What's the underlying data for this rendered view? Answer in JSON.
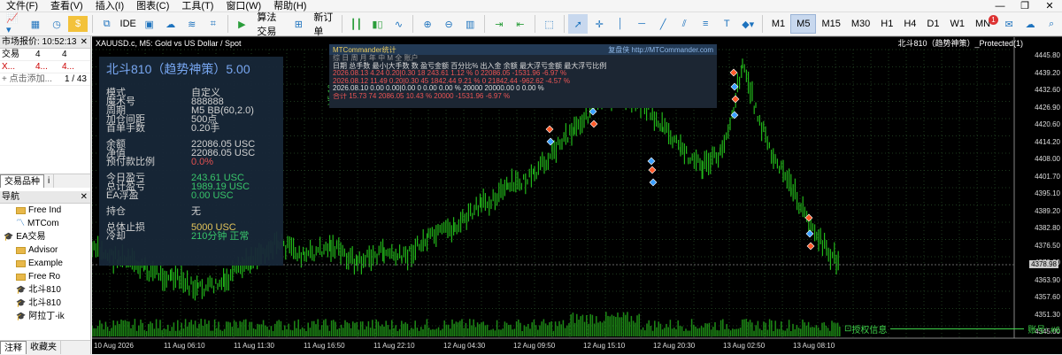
{
  "menu": {
    "items": [
      "文件(F)",
      "查看(V)",
      "插入(I)",
      "图表(C)",
      "工具(T)",
      "窗口(W)",
      "帮助(H)"
    ],
    "win_controls": [
      "—",
      "❐",
      "✕"
    ]
  },
  "toolbar": {
    "ide_label": "IDE",
    "algo_label": "算法交易",
    "new_order_label": "新订单",
    "timeframes": [
      "M1",
      "M5",
      "M15",
      "M30",
      "H1",
      "H4",
      "D1",
      "W1",
      "MN"
    ],
    "active_timeframe": "M5",
    "notify_count": "1"
  },
  "market_watch": {
    "title": "市场报价: 10:52:13",
    "col1": "交易",
    "col2": "4",
    "row_symbol": "X...",
    "row_bid": "4...",
    "row_ask": "4...",
    "add_label": "+ 点击添加...",
    "count": "1 / 43"
  },
  "left_tabs": {
    "tab1": "交易品种",
    "tab2": "i"
  },
  "navigator": {
    "title": "导航",
    "items": [
      {
        "label": "Free Ind",
        "type": "folder"
      },
      {
        "label": "MTCom",
        "type": "ind"
      },
      {
        "label": "EA交易",
        "type": "ea"
      },
      {
        "label": "Advisor",
        "type": "folder"
      },
      {
        "label": "Example",
        "type": "folder"
      },
      {
        "label": "Free Ro",
        "type": "folder"
      },
      {
        "label": "北斗810",
        "type": "ea"
      },
      {
        "label": "北斗810",
        "type": "ea"
      },
      {
        "label": "阿拉丁-ik",
        "type": "ea"
      }
    ]
  },
  "bottom_tabs": {
    "tab1": "注释",
    "tab2": "收藏夹"
  },
  "chart": {
    "symbol_line": "XAUUSD.c, M5:  Gold vs US Dollar / Spot",
    "ea_label": "北斗810（趋势神策）_Protected(1)",
    "side_label": "V5.16",
    "current_price": "4378.98",
    "yticks": [
      "4445.80",
      "4439.20",
      "4432.60",
      "4426.90",
      "4420.60",
      "4414.20",
      "4408.00",
      "4401.70",
      "4395.10",
      "4389.20",
      "4382.80",
      "4376.50",
      "4370.20",
      "4363.90",
      "4357.60",
      "4351.30",
      "4345.00"
    ],
    "xticks": [
      "10 Aug 2026",
      "11 Aug 06:10",
      "11 Aug 11:30",
      "11 Aug 16:50",
      "11 Aug 22:10",
      "12 Aug 04:30",
      "12 Aug 09:50",
      "12 Aug 15:10",
      "12 Aug 20:30",
      "13 Aug 02:50",
      "13 Aug 08:10"
    ]
  },
  "info": {
    "header": "北斗810（趋势神策）5.00",
    "rows": [
      {
        "k": "模式",
        "v": "自定义",
        "c": ""
      },
      {
        "k": "魔术号",
        "v": "888888",
        "c": ""
      },
      {
        "k": "周期",
        "v": "M5  BB(60,2.0)",
        "c": ""
      },
      {
        "k": "加仓间距",
        "v": "500点",
        "c": ""
      },
      {
        "k": "首单手数",
        "v": "0.20手",
        "c": ""
      },
      {
        "gap": true
      },
      {
        "k": "余额",
        "v": "22086.05 USC",
        "c": ""
      },
      {
        "k": "净值",
        "v": "22086.05 USC",
        "c": ""
      },
      {
        "k": "预付款比例",
        "v": "0.0%",
        "c": "red"
      },
      {
        "gap": true
      },
      {
        "k": "今日盈亏",
        "v": "243.61 USC",
        "c": "grn"
      },
      {
        "k": "总计盈亏",
        "v": "1989.19 USC",
        "c": "grn"
      },
      {
        "k": "EA浮盈",
        "v": "0.00 USC",
        "c": "grn"
      },
      {
        "gap": true
      },
      {
        "k": "持仓",
        "v": "无",
        "c": ""
      },
      {
        "gap": true
      },
      {
        "k": "总体止损",
        "v": "5000 USC",
        "c": "yel"
      },
      {
        "k": "冷却",
        "v": "210分钟  正常",
        "c": "grn"
      }
    ]
  },
  "stats": {
    "title": "MTCommander统计",
    "link": "复盘侠 http://MTCommander.com",
    "tabs": "综 日 周 月 年 中 M 全 账户",
    "header": "日期       总手数 最小|大手数 数 盈亏金额    百分比% 出入金   余额       最大浮亏金额 最大浮亏比例",
    "rows": [
      {
        "t": "2026.08.13   4.24   0.20|0.30  18   243.61     1.12 %   0       22086.05   -1531.96    -6.97 %",
        "c": "red"
      },
      {
        "t": "2026.08.12   11.49  0.20|0.30  45   1842.44    9.21 %   0       21842.44   -962.62     -4.57 %",
        "c": "red"
      },
      {
        "t": "2026.08.10   0.00   0.00|0.00  0    0.00       0.00 %   20000   20000.00   0           0.00 %",
        "c": ""
      },
      {
        "t": "合计       15.73             74   2086.05    10.43 %  20000               -1531.96    -6.97 %",
        "c": "red"
      }
    ]
  },
  "footer": {
    "auth_label": "授权信息",
    "account_label": "账号: #6"
  },
  "colors": {
    "candle_green": "#22b61a",
    "panel_bg": "#182838",
    "chart_bg": "#000000"
  }
}
